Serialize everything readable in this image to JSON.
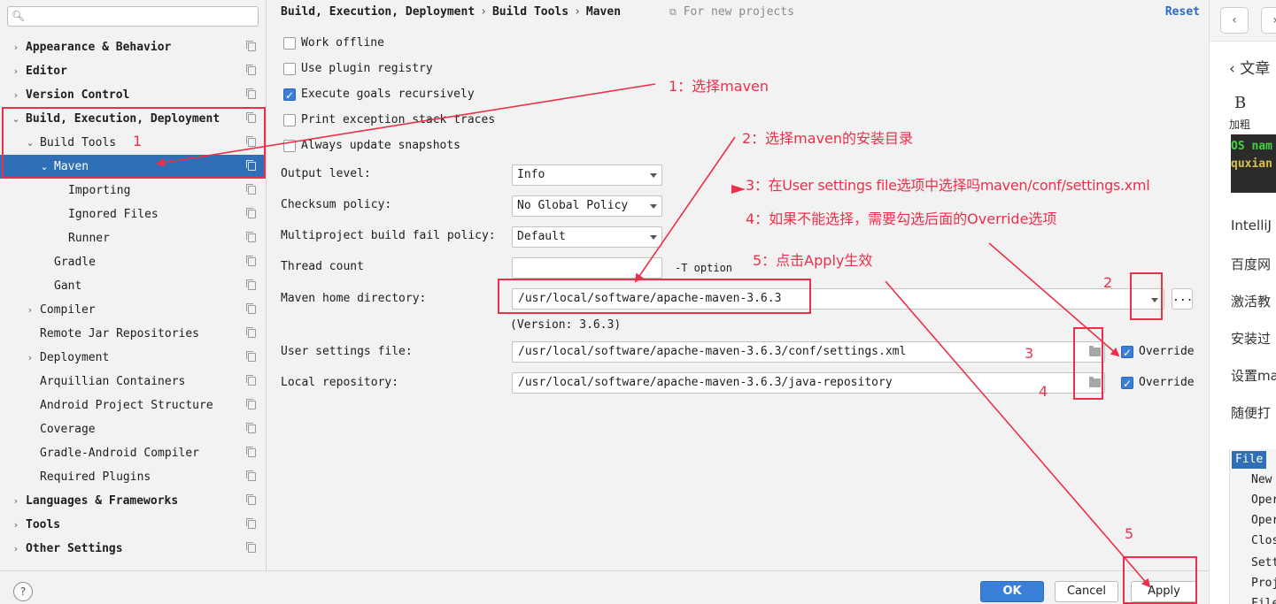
{
  "sidebar": {
    "search_placeholder": "",
    "items": [
      {
        "label": "Appearance & Behavior"
      },
      {
        "label": "Editor"
      },
      {
        "label": "Version Control"
      },
      {
        "label": "Build, Execution, Deployment"
      },
      {
        "label": "Build Tools"
      },
      {
        "label": "Maven"
      },
      {
        "label": "Importing"
      },
      {
        "label": "Ignored Files"
      },
      {
        "label": "Runner"
      },
      {
        "label": "Gradle"
      },
      {
        "label": "Gant"
      },
      {
        "label": "Compiler"
      },
      {
        "label": "Remote Jar Repositories"
      },
      {
        "label": "Deployment"
      },
      {
        "label": "Arquillian Containers"
      },
      {
        "label": "Android Project Structure"
      },
      {
        "label": "Coverage"
      },
      {
        "label": "Gradle-Android Compiler"
      },
      {
        "label": "Required Plugins"
      },
      {
        "label": "Languages & Frameworks"
      },
      {
        "label": "Tools"
      },
      {
        "label": "Other Settings"
      }
    ]
  },
  "header": {
    "breadcrumb": [
      "Build, Execution, Deployment",
      "Build Tools",
      "Maven"
    ],
    "separator": "›",
    "for_new_projects": "For new projects",
    "reset": "Reset"
  },
  "options": {
    "work_offline": "Work offline",
    "use_plugin_registry": "Use plugin registry",
    "execute_goals_recursively": "Execute goals recursively",
    "print_exception_stack_traces": "Print exception stack traces",
    "always_update_snapshots": "Always update snapshots"
  },
  "form": {
    "output_level_label": "Output level:",
    "output_level_value": "Info",
    "checksum_label": "Checksum policy:",
    "checksum_value": "No Global Policy",
    "fail_policy_label": "Multiproject build fail policy:",
    "fail_policy_value": "Default",
    "thread_count_label": "Thread count",
    "thread_count_value": "",
    "t_option": "-T option",
    "maven_home_label": "Maven home directory:",
    "maven_home_value": "/usr/local/software/apache-maven-3.6.3",
    "version_text": "(Version: 3.6.3)",
    "browse_label": "...",
    "user_settings_label": "User settings file:",
    "user_settings_value": "/usr/local/software/apache-maven-3.6.3/conf/settings.xml",
    "local_repo_label": "Local repository:",
    "local_repo_value": "/usr/local/software/apache-maven-3.6.3/java-repository",
    "override_label": "Override"
  },
  "footer": {
    "help": "?",
    "ok": "OK",
    "cancel": "Cancel",
    "apply": "Apply"
  },
  "right_panel": {
    "back_label": "文章",
    "bold_label": "加粗",
    "bold_glyph": "B",
    "code_line1": "OS nam",
    "code_line2": "quxian",
    "lines": [
      "IntelliJ",
      "百度网",
      "激活教",
      "安装过",
      "设置ma",
      "随便打"
    ],
    "menu_file": "File",
    "menu_items": [
      "New",
      "Oper",
      "Oper",
      "Clos",
      "Sett",
      "Proj",
      "File"
    ]
  },
  "annotations": {
    "step1": "1：选择maven",
    "step2": "2：选择maven的安装目录",
    "step3": "3：在User settings file选项中选择吗maven/conf/settings.xml",
    "step4": "4：如果不能选择，需要勾选后面的Override选项",
    "step5": "5：点击Apply生效",
    "num1": "1",
    "num2": "2",
    "num3": "3",
    "num4": "4",
    "num5": "5"
  },
  "colors": {
    "selection": "#2e6fb8",
    "annotation": "#ee2f49",
    "accent_button": "#3a80d9"
  }
}
